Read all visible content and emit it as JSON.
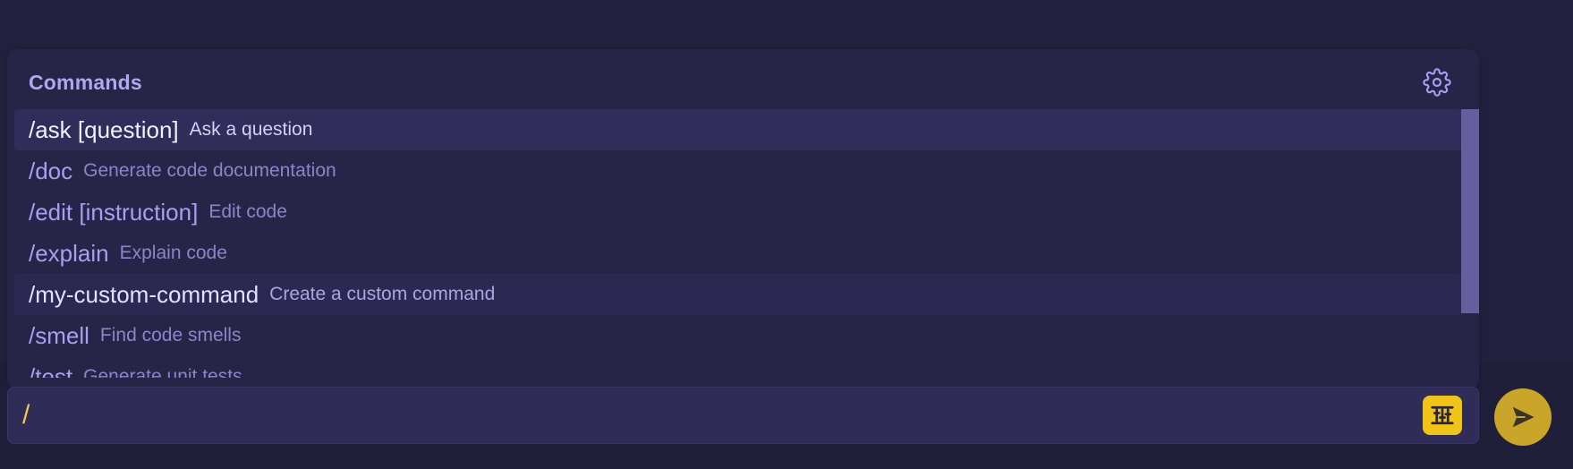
{
  "popup": {
    "title": "Commands",
    "settings_icon": "gear-icon"
  },
  "commands": [
    {
      "name": "/ask [question]",
      "description": "Ask a question",
      "state": "selected"
    },
    {
      "name": "/doc",
      "description": "Generate code documentation",
      "state": "normal"
    },
    {
      "name": "/edit [instruction]",
      "description": "Edit code",
      "state": "normal"
    },
    {
      "name": "/explain",
      "description": "Explain code",
      "state": "normal"
    },
    {
      "name": "/my-custom-command",
      "description": "Create a custom command",
      "state": "hovered"
    },
    {
      "name": "/smell",
      "description": "Find code smells",
      "state": "normal"
    },
    {
      "name": "/test",
      "description": "Generate unit tests",
      "state": "normal"
    }
  ],
  "input": {
    "value": "/",
    "settings_icon": "sliders-icon",
    "send_icon": "send-icon"
  },
  "colors": {
    "background": "#22213f",
    "accent": "#b3a6ee",
    "selected_row": "#302d5a",
    "input_text": "#f2c94c",
    "settings_button": "#f0c419",
    "send_button": "#c9a52a"
  }
}
